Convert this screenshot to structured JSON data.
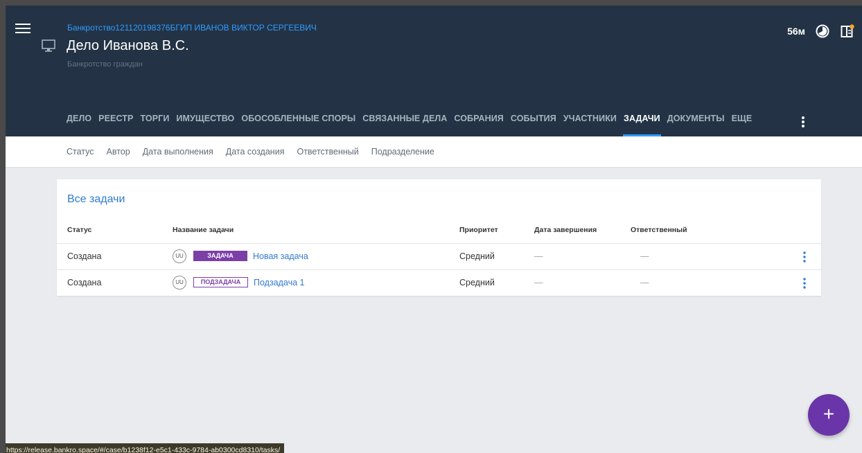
{
  "header": {
    "supertitle": "Банкротство121120198376БГИП ИВАНОВ ВИКТОР СЕРГЕЕВИЧ",
    "title": "Дело Иванова В.С.",
    "subtitle": "Банкротство граждан",
    "time_label": "56м",
    "icons": [
      "menu-icon",
      "monitor-icon",
      "timer-icon",
      "notifications-panel-icon"
    ],
    "notification_dot_color": "#f5a623"
  },
  "tabs": [
    {
      "label": "ДЕЛО"
    },
    {
      "label": "РЕЕСТР"
    },
    {
      "label": "ТОРГИ"
    },
    {
      "label": "ИМУЩЕСТВО"
    },
    {
      "label": "ОБОСОБЛЕННЫЕ СПОРЫ"
    },
    {
      "label": "СВЯЗАННЫЕ ДЕЛА"
    },
    {
      "label": "СОБРАНИЯ"
    },
    {
      "label": "СОБЫТИЯ"
    },
    {
      "label": "УЧАСТНИКИ"
    },
    {
      "label": "ЗАДАЧИ",
      "active": true
    },
    {
      "label": "ДОКУМЕНТЫ"
    },
    {
      "label": "ЕЩЕ"
    }
  ],
  "filters": [
    "Статус",
    "Автор",
    "Дата выполнения",
    "Дата создания",
    "Ответственный",
    "Подразделение"
  ],
  "tasks": {
    "title": "Все задачи",
    "columns": {
      "status": "Статус",
      "name": "Название задачи",
      "priority": "Приоритет",
      "due": "Дата завершения",
      "assignee": "Ответственный"
    },
    "rows": [
      {
        "status": "Создана",
        "avatar": "UU",
        "type": "ЗАДАЧА",
        "name": "Новая задача",
        "priority": "Средний",
        "due": "—",
        "assignee": "—"
      },
      {
        "status": "Создана",
        "avatar": "UU",
        "type": "ПОДЗАДАЧА",
        "name": "Подзадача 1",
        "priority": "Средний",
        "due": "—",
        "assignee": "—"
      }
    ]
  },
  "fab": {
    "label": "+"
  },
  "status_bar": {
    "url": "https://release.bankro.space/#/case/b1238f12-e5c1-433c-9784-ab0300cd8310/tasks/"
  },
  "colors": {
    "header_bg": "#233345",
    "accent": "#2f9bff",
    "badge_purple": "#7b3fa7",
    "fab": "#6a35a8"
  }
}
